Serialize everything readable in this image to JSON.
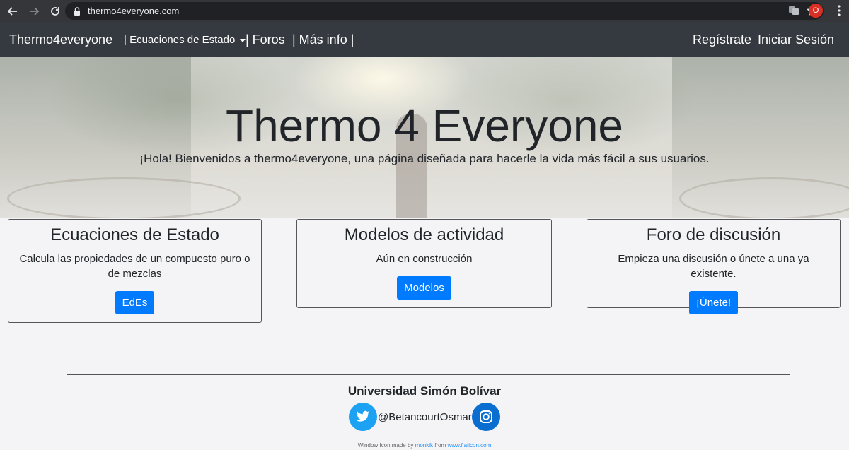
{
  "browser": {
    "url": "thermo4everyone.com",
    "profile_initial": "O"
  },
  "navbar": {
    "brand": "Thermo4everyone",
    "items": [
      {
        "label": "| Ecuaciones de Estado"
      },
      {
        "label": "| Foros"
      },
      {
        "label": "| Más info |"
      }
    ],
    "register": "Regístrate",
    "login": "Iniciar Sesión"
  },
  "hero": {
    "title": "Thermo 4 Everyone",
    "subtitle": "¡Hola! Bienvenidos a thermo4everyone, una página diseñada para hacerle la vida más fácil a sus usuarios."
  },
  "cards": [
    {
      "title": "Ecuaciones de Estado",
      "text": "Calcula las propiedades de un compuesto puro o de mezclas",
      "button": "EdEs"
    },
    {
      "title": "Modelos de actividad",
      "text": "Aún en construcción",
      "button": "Modelos"
    },
    {
      "title": "Foro de discusión",
      "text": "Empieza una discusión o únete a una ya existente.",
      "button": "¡Únete!"
    }
  ],
  "footer": {
    "university": "Universidad Simón Bolívar",
    "twitter_handle": "@BetancourtOsmar",
    "credit_prefix": "Window Icon made by",
    "credit_author": "monkik",
    "credit_mid": "from",
    "credit_site": "www.flaticon.com"
  },
  "colors": {
    "navbar_bg": "#343a40",
    "button_primary": "#007bff",
    "twitter": "#1da1f2",
    "instagram": "#0a6ed1"
  }
}
